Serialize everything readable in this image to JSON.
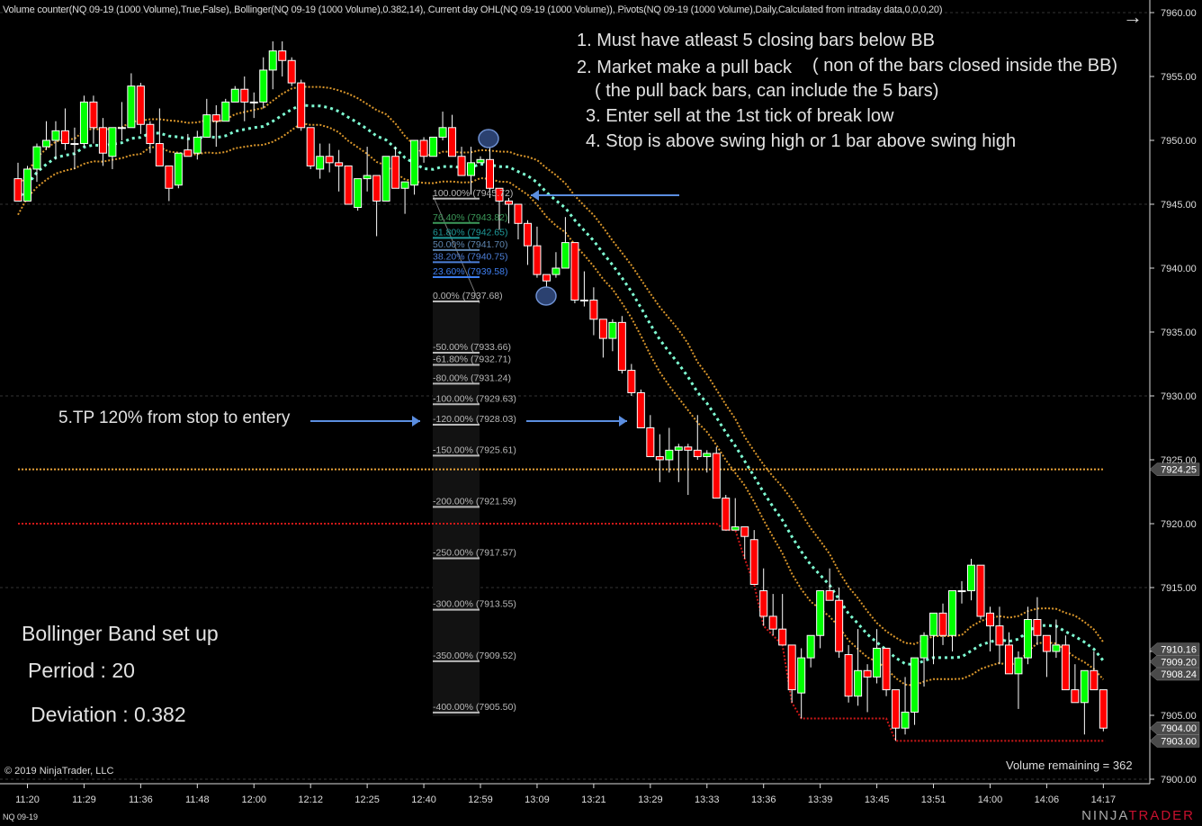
{
  "header": "Volume counter(NQ 09-19 (1000 Volume),True,False), Bollinger(NQ 09-19 (1000 Volume),0.382,14), Current day OHL(NQ 09-19 (1000 Volume)), Pivots(NQ 09-19 (1000 Volume),Daily,Calculated from intraday data,0,0,0,20)",
  "instrument": "NQ 09-19",
  "copyright": "© 2019 NinjaTrader, LLC",
  "volume_remaining": "Volume remaining = 362",
  "logo": {
    "part1": "NINJA",
    "part2": "TRADER"
  },
  "icons": {
    "scroll_right": "arrow-right-icon"
  },
  "notes": {
    "rule1": "1. Must have atleast 5 closing bars below BB",
    "rule2": "2. Market make a pull back",
    "rule2b": "( non of the bars closed inside the BB)",
    "rule2c": "( the pull back bars, can include the 5 bars)",
    "rule3": "3. Enter sell at the 1st tick of break low",
    "rule4": "4. Stop is above swing high or 1 bar above swing high",
    "rule5": "5.TP 120% from stop to entery",
    "bb_title": "Bollinger Band set up",
    "bb_period": "Perriod : 20",
    "bb_deviation": "Deviation : 0.382"
  },
  "colors": {
    "background": "#000000",
    "up_candle": "#00ff00",
    "down_candle": "#ff0000",
    "bb_outer": "#d9962b",
    "bb_middle": "#7fffd4",
    "pivot": "#e8a33a",
    "day_low": "#d01818",
    "annotation_arrow": "#5b8ee0"
  },
  "chart_data": {
    "type": "candlestick",
    "ylim": [
      7900,
      7960
    ],
    "yticks": [
      "7960.00",
      "7955.00",
      "7950.00",
      "7945.00",
      "7940.00",
      "7935.00",
      "7930.00",
      "7925.00",
      "7920.00",
      "7915.00",
      "7910.00",
      "7905.00",
      "7900.00"
    ],
    "xticks": [
      "11:20",
      "11:29",
      "11:36",
      "11:48",
      "12:00",
      "12:12",
      "12:25",
      "12:40",
      "12:59",
      "13:09",
      "13:21",
      "13:29",
      "13:33",
      "13:36",
      "13:39",
      "13:45",
      "13:51",
      "14:00",
      "14:06",
      "14:17"
    ],
    "candles_ohlc": [
      [
        7947,
        7948.25,
        7945.25,
        7945.25
      ],
      [
        7945.25,
        7948,
        7945.25,
        7947.75
      ],
      [
        7947.75,
        7949.75,
        7946.75,
        7949.5
      ],
      [
        7949.5,
        7951.5,
        7949.25,
        7950
      ],
      [
        7950,
        7951.5,
        7948.5,
        7950.75
      ],
      [
        7950.75,
        7952.5,
        7949.25,
        7949.75
      ],
      [
        7949.75,
        7951,
        7947.75,
        7949.75
      ],
      [
        7949.75,
        7953.5,
        7949.5,
        7953
      ],
      [
        7953,
        7953.5,
        7949.75,
        7951
      ],
      [
        7951,
        7951.75,
        7948,
        7949
      ],
      [
        7948.75,
        7951,
        7947.75,
        7951
      ],
      [
        7951,
        7953,
        7950,
        7951
      ],
      [
        7951,
        7955.25,
        7951,
        7954.25
      ],
      [
        7954.25,
        7954.5,
        7950.5,
        7951.25
      ],
      [
        7951.25,
        7951.5,
        7949,
        7949.75
      ],
      [
        7949.75,
        7952.5,
        7948,
        7948
      ],
      [
        7948,
        7948,
        7945.25,
        7946.25
      ],
      [
        7946.5,
        7949,
        7946.25,
        7949
      ],
      [
        7949.25,
        7950.5,
        7948.75,
        7948.75
      ],
      [
        7949,
        7950.75,
        7948.5,
        7950.25
      ],
      [
        7950.25,
        7953.25,
        7950.25,
        7952
      ],
      [
        7952,
        7952.75,
        7949.5,
        7951.5
      ],
      [
        7951.5,
        7953.25,
        7951.5,
        7953
      ],
      [
        7953,
        7954.25,
        7953,
        7954
      ],
      [
        7954,
        7955,
        7951.5,
        7953
      ],
      [
        7953,
        7953.75,
        7951.75,
        7953
      ],
      [
        7953,
        7956.5,
        7952.5,
        7955.5
      ],
      [
        7955.5,
        7957.75,
        7954,
        7957
      ],
      [
        7957,
        7957.75,
        7955,
        7956.25
      ],
      [
        7956.25,
        7956.5,
        7954.25,
        7954.5
      ],
      [
        7954.5,
        7954.75,
        7950.75,
        7951
      ],
      [
        7951,
        7951,
        7947.75,
        7948
      ],
      [
        7947.75,
        7949.75,
        7947,
        7948.75
      ],
      [
        7948.75,
        7949.75,
        7947.5,
        7948.25
      ],
      [
        7948.25,
        7949.25,
        7946,
        7948
      ],
      [
        7948,
        7948,
        7945,
        7945
      ],
      [
        7944.75,
        7947,
        7944.5,
        7947
      ],
      [
        7947,
        7949.5,
        7946,
        7947.25
      ],
      [
        7947.25,
        7947.25,
        7942.5,
        7945.25
      ],
      [
        7945.25,
        7948.75,
        7945.25,
        7948.75
      ],
      [
        7948.75,
        7949.5,
        7946.25,
        7946.25
      ],
      [
        7946.25,
        7946.75,
        7944.25,
        7946.75
      ],
      [
        7946.5,
        7950,
        7945.75,
        7950
      ],
      [
        7950,
        7950.25,
        7948.25,
        7948.75
      ],
      [
        7948.75,
        7950.25,
        7948.75,
        7950.25
      ],
      [
        7950.25,
        7952.25,
        7950,
        7951
      ],
      [
        7951,
        7952,
        7948.75,
        7948.75
      ],
      [
        7948.75,
        7949.5,
        7947.25,
        7947.25
      ],
      [
        7947.25,
        7949.5,
        7945.75,
        7948.25
      ],
      [
        7948.25,
        7948.75,
        7948.25,
        7948.5
      ],
      [
        7948.5,
        7950.25,
        7945.5,
        7946.25
      ],
      [
        7946.25,
        7946.25,
        7943,
        7945.25
      ],
      [
        7945.25,
        7945.5,
        7943.5,
        7945
      ],
      [
        7945,
        7945,
        7942.25,
        7943.5
      ],
      [
        7943.5,
        7943.75,
        7940.25,
        7941.75
      ],
      [
        7941.75,
        7943.25,
        7939.25,
        7939.5
      ],
      [
        7939.5,
        7939.5,
        7937.75,
        7939
      ],
      [
        7939.5,
        7941.25,
        7939.25,
        7940
      ],
      [
        7940,
        7944,
        7940,
        7942
      ],
      [
        7942,
        7942,
        7937.25,
        7937.5
      ],
      [
        7937.5,
        7939.75,
        7937,
        7937.5
      ],
      [
        7937.5,
        7938.5,
        7934.75,
        7936
      ],
      [
        7936,
        7936,
        7933,
        7934.5
      ],
      [
        7934.5,
        7936,
        7933.5,
        7935.75
      ],
      [
        7935.75,
        7936.25,
        7931.75,
        7932
      ],
      [
        7932,
        7932.5,
        7930,
        7930.25
      ],
      [
        7930.25,
        7930.5,
        7927.5,
        7927.5
      ],
      [
        7927.5,
        7928.5,
        7925.25,
        7925.25
      ],
      [
        7925.25,
        7927,
        7923.25,
        7925
      ],
      [
        7925,
        7927.5,
        7924,
        7925.75
      ],
      [
        7925.75,
        7926.25,
        7923.25,
        7926
      ],
      [
        7926,
        7926.25,
        7922.25,
        7925.75
      ],
      [
        7925.75,
        7928.5,
        7925,
        7925.25
      ],
      [
        7925.25,
        7925.75,
        7924,
        7925.5
      ],
      [
        7925.5,
        7926,
        7922,
        7922
      ],
      [
        7922,
        7922.25,
        7919.5,
        7919.5
      ],
      [
        7919.5,
        7922,
        7919.5,
        7919.75
      ],
      [
        7919.75,
        7919.75,
        7917.25,
        7919
      ],
      [
        7918.75,
        7919.5,
        7915.25,
        7915.25
      ],
      [
        7914.75,
        7916.5,
        7912,
        7912.75
      ],
      [
        7912.75,
        7914.5,
        7911.25,
        7911.75
      ],
      [
        7911.75,
        7914.5,
        7910.5,
        7910.5
      ],
      [
        7910.5,
        7910.5,
        7906,
        7907
      ],
      [
        7906.75,
        7910.25,
        7904.75,
        7909.5
      ],
      [
        7909.5,
        7911.25,
        7908.75,
        7911.25
      ],
      [
        7911.25,
        7914.75,
        7910.25,
        7914.75
      ],
      [
        7914.75,
        7916.5,
        7914,
        7914
      ],
      [
        7914,
        7915,
        7909.5,
        7910
      ],
      [
        7909.75,
        7910.5,
        7906,
        7906.5
      ],
      [
        7906.5,
        7911.75,
        7905.75,
        7908.5
      ],
      [
        7908.5,
        7909,
        7905.25,
        7908
      ],
      [
        7908,
        7911.75,
        7907.5,
        7910.25
      ],
      [
        7910.25,
        7910.25,
        7906.5,
        7907
      ],
      [
        7907,
        7907,
        7903,
        7904
      ],
      [
        7904,
        7908,
        7903.5,
        7905.25
      ],
      [
        7905.25,
        7909.5,
        7904.25,
        7909.5
      ],
      [
        7909.5,
        7911.5,
        7907.25,
        7911.25
      ],
      [
        7911.25,
        7913,
        7909,
        7913
      ],
      [
        7913,
        7913.75,
        7910.5,
        7911.25
      ],
      [
        7911.25,
        7914.75,
        7910,
        7914.75
      ],
      [
        7914.75,
        7915.5,
        7913.75,
        7914.75
      ],
      [
        7914.75,
        7917.25,
        7914,
        7916.75
      ],
      [
        7916.75,
        7916.75,
        7912.5,
        7912.75
      ],
      [
        7913,
        7913.5,
        7910,
        7912
      ],
      [
        7912,
        7913.5,
        7909,
        7910.5
      ],
      [
        7910.5,
        7911.5,
        7908.25,
        7908.25
      ],
      [
        7908.25,
        7910,
        7905.5,
        7909.5
      ],
      [
        7909.5,
        7913.5,
        7909,
        7912.5
      ],
      [
        7912.5,
        7914.25,
        7910.5,
        7911.25
      ],
      [
        7911.25,
        7911.25,
        7908,
        7910
      ],
      [
        7910,
        7912.5,
        7909.5,
        7910.5
      ],
      [
        7910.5,
        7911.25,
        7907,
        7907
      ],
      [
        7907,
        7909,
        7906,
        7906
      ],
      [
        7906,
        7908.5,
        7903.5,
        7908.5
      ],
      [
        7908.5,
        7910,
        7907,
        7907
      ],
      [
        7907,
        7907,
        7903.75,
        7904
      ]
    ],
    "bollinger": {
      "period": 14,
      "deviation": 0.382
    },
    "pivot_level": 7924.25,
    "prior_day_low": 7920,
    "price_markers": [
      {
        "label": "7924.25",
        "price": 7924.25,
        "kind": "pivot"
      },
      {
        "label": "7910.16",
        "price": 7910.16,
        "kind": "bb-upper"
      },
      {
        "label": "7909.20",
        "price": 7909.2,
        "kind": "bb-middle"
      },
      {
        "label": "7908.24",
        "price": 7908.24,
        "kind": "bb-lower"
      },
      {
        "label": "7904.00",
        "price": 7904.0,
        "kind": "last"
      },
      {
        "label": "7903.00",
        "price": 7903.0,
        "kind": "day-low"
      }
    ],
    "fibonacci": {
      "levels": [
        {
          "label": "100.00% (7945.72)",
          "price": 7945.72,
          "color": "#b8b8b8"
        },
        {
          "label": "76.40% (7943.82)",
          "price": 7943.82,
          "color": "#3c9a5a"
        },
        {
          "label": "61.80% (7942.65)",
          "price": 7942.65,
          "color": "#1f9a9a"
        },
        {
          "label": "50.00% (7941.70)",
          "price": 7941.7,
          "color": "#5f86b0"
        },
        {
          "label": "38.20% (7940.75)",
          "price": 7940.75,
          "color": "#4d7fd8"
        },
        {
          "label": "23.60% (7939.58)",
          "price": 7939.58,
          "color": "#3f7ff0"
        },
        {
          "label": "0.00% (7937.68)",
          "price": 7937.68,
          "color": "#b8b8b8"
        },
        {
          "label": "-50.00% (7933.66)",
          "price": 7933.66,
          "color": "#b8b8b8"
        },
        {
          "label": "-61.80% (7932.71)",
          "price": 7932.71,
          "color": "#b8b8b8"
        },
        {
          "label": "-80.00% (7931.24)",
          "price": 7931.24,
          "color": "#b8b8b8"
        },
        {
          "label": "-100.00% (7929.63)",
          "price": 7929.63,
          "color": "#b8b8b8"
        },
        {
          "label": "-120.00% (7928.03)",
          "price": 7928.03,
          "color": "#b8b8b8"
        },
        {
          "label": "-150.00% (7925.61)",
          "price": 7925.61,
          "color": "#b8b8b8"
        },
        {
          "label": "-200.00% (7921.59)",
          "price": 7921.59,
          "color": "#b8b8b8"
        },
        {
          "label": "-250.00% (7917.57)",
          "price": 7917.57,
          "color": "#b8b8b8"
        },
        {
          "label": "-300.00% (7913.55)",
          "price": 7913.55,
          "color": "#b8b8b8"
        },
        {
          "label": "-350.00% (7909.52)",
          "price": 7909.52,
          "color": "#b8b8b8"
        },
        {
          "label": "-400.00% (7905.50)",
          "price": 7905.5,
          "color": "#b8b8b8"
        }
      ]
    }
  }
}
